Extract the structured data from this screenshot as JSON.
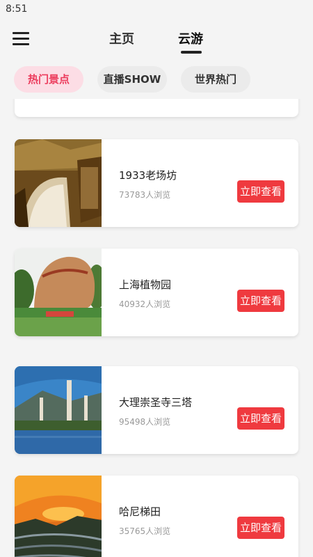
{
  "status_bar": {
    "time": "8:51"
  },
  "nav": {
    "tabs": [
      {
        "label": "主页"
      },
      {
        "label": "云游"
      }
    ]
  },
  "categories": [
    {
      "label": "热门景点"
    },
    {
      "label": "直播SHOW"
    },
    {
      "label": "世界热门"
    }
  ],
  "attractions": [
    {
      "title": "1933老场坊",
      "views": "73783人浏览",
      "button": "立即查看"
    },
    {
      "title": "上海植物园",
      "views": "40932人浏览",
      "button": "立即查看"
    },
    {
      "title": "大理崇圣寺三塔",
      "views": "95498人浏览",
      "button": "立即查看"
    },
    {
      "title": "哈尼梯田",
      "views": "35765人浏览",
      "button": "立即查看"
    }
  ],
  "colors": {
    "accent_red": "#ef3a3f",
    "active_chip_bg": "#fcdde5",
    "active_chip_text": "#ec3b5c"
  }
}
